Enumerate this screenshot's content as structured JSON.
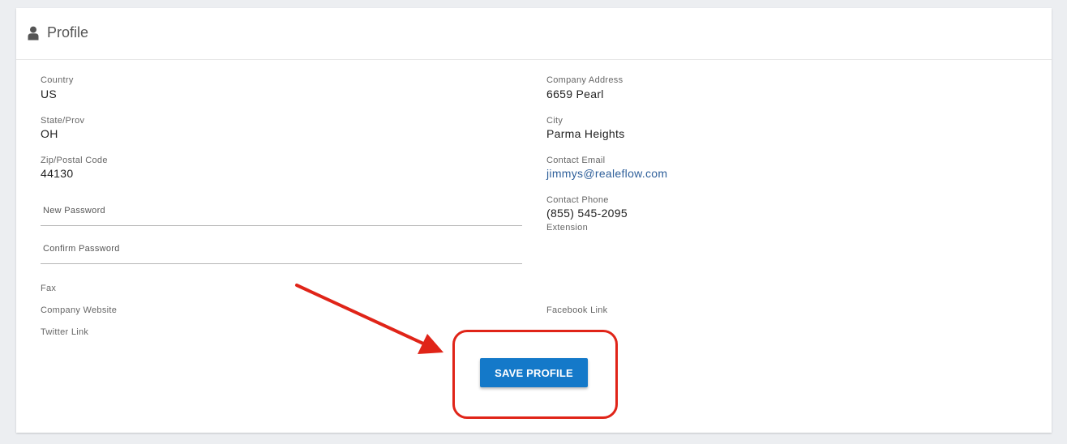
{
  "header": {
    "title": "Profile",
    "icon": "user-icon"
  },
  "left": {
    "country": {
      "label": "Country",
      "value": "US"
    },
    "state": {
      "label": "State/Prov",
      "value": "OH"
    },
    "zip": {
      "label": "Zip/Postal Code",
      "value": "44130"
    },
    "new_password": {
      "placeholder": "New Password",
      "value": ""
    },
    "confirm_password": {
      "placeholder": "Confirm Password",
      "value": ""
    },
    "fax": {
      "label": "Fax"
    },
    "company_website": {
      "label": "Company Website"
    },
    "twitter": {
      "label": "Twitter Link"
    }
  },
  "right": {
    "address": {
      "label": "Company Address",
      "value": "6659 Pearl"
    },
    "city": {
      "label": "City",
      "value": "Parma Heights"
    },
    "email": {
      "label": "Contact Email",
      "value": "jimmys@realeflow.com"
    },
    "phone": {
      "label": "Contact Phone",
      "value": "(855) 545-2095"
    },
    "extension": {
      "label": "Extension"
    },
    "facebook": {
      "label": "Facebook Link"
    }
  },
  "actions": {
    "save_label": "SAVE PROFILE"
  },
  "colors": {
    "button": "#1479c9",
    "annotation": "#e02418",
    "link": "#2e5f9a"
  }
}
